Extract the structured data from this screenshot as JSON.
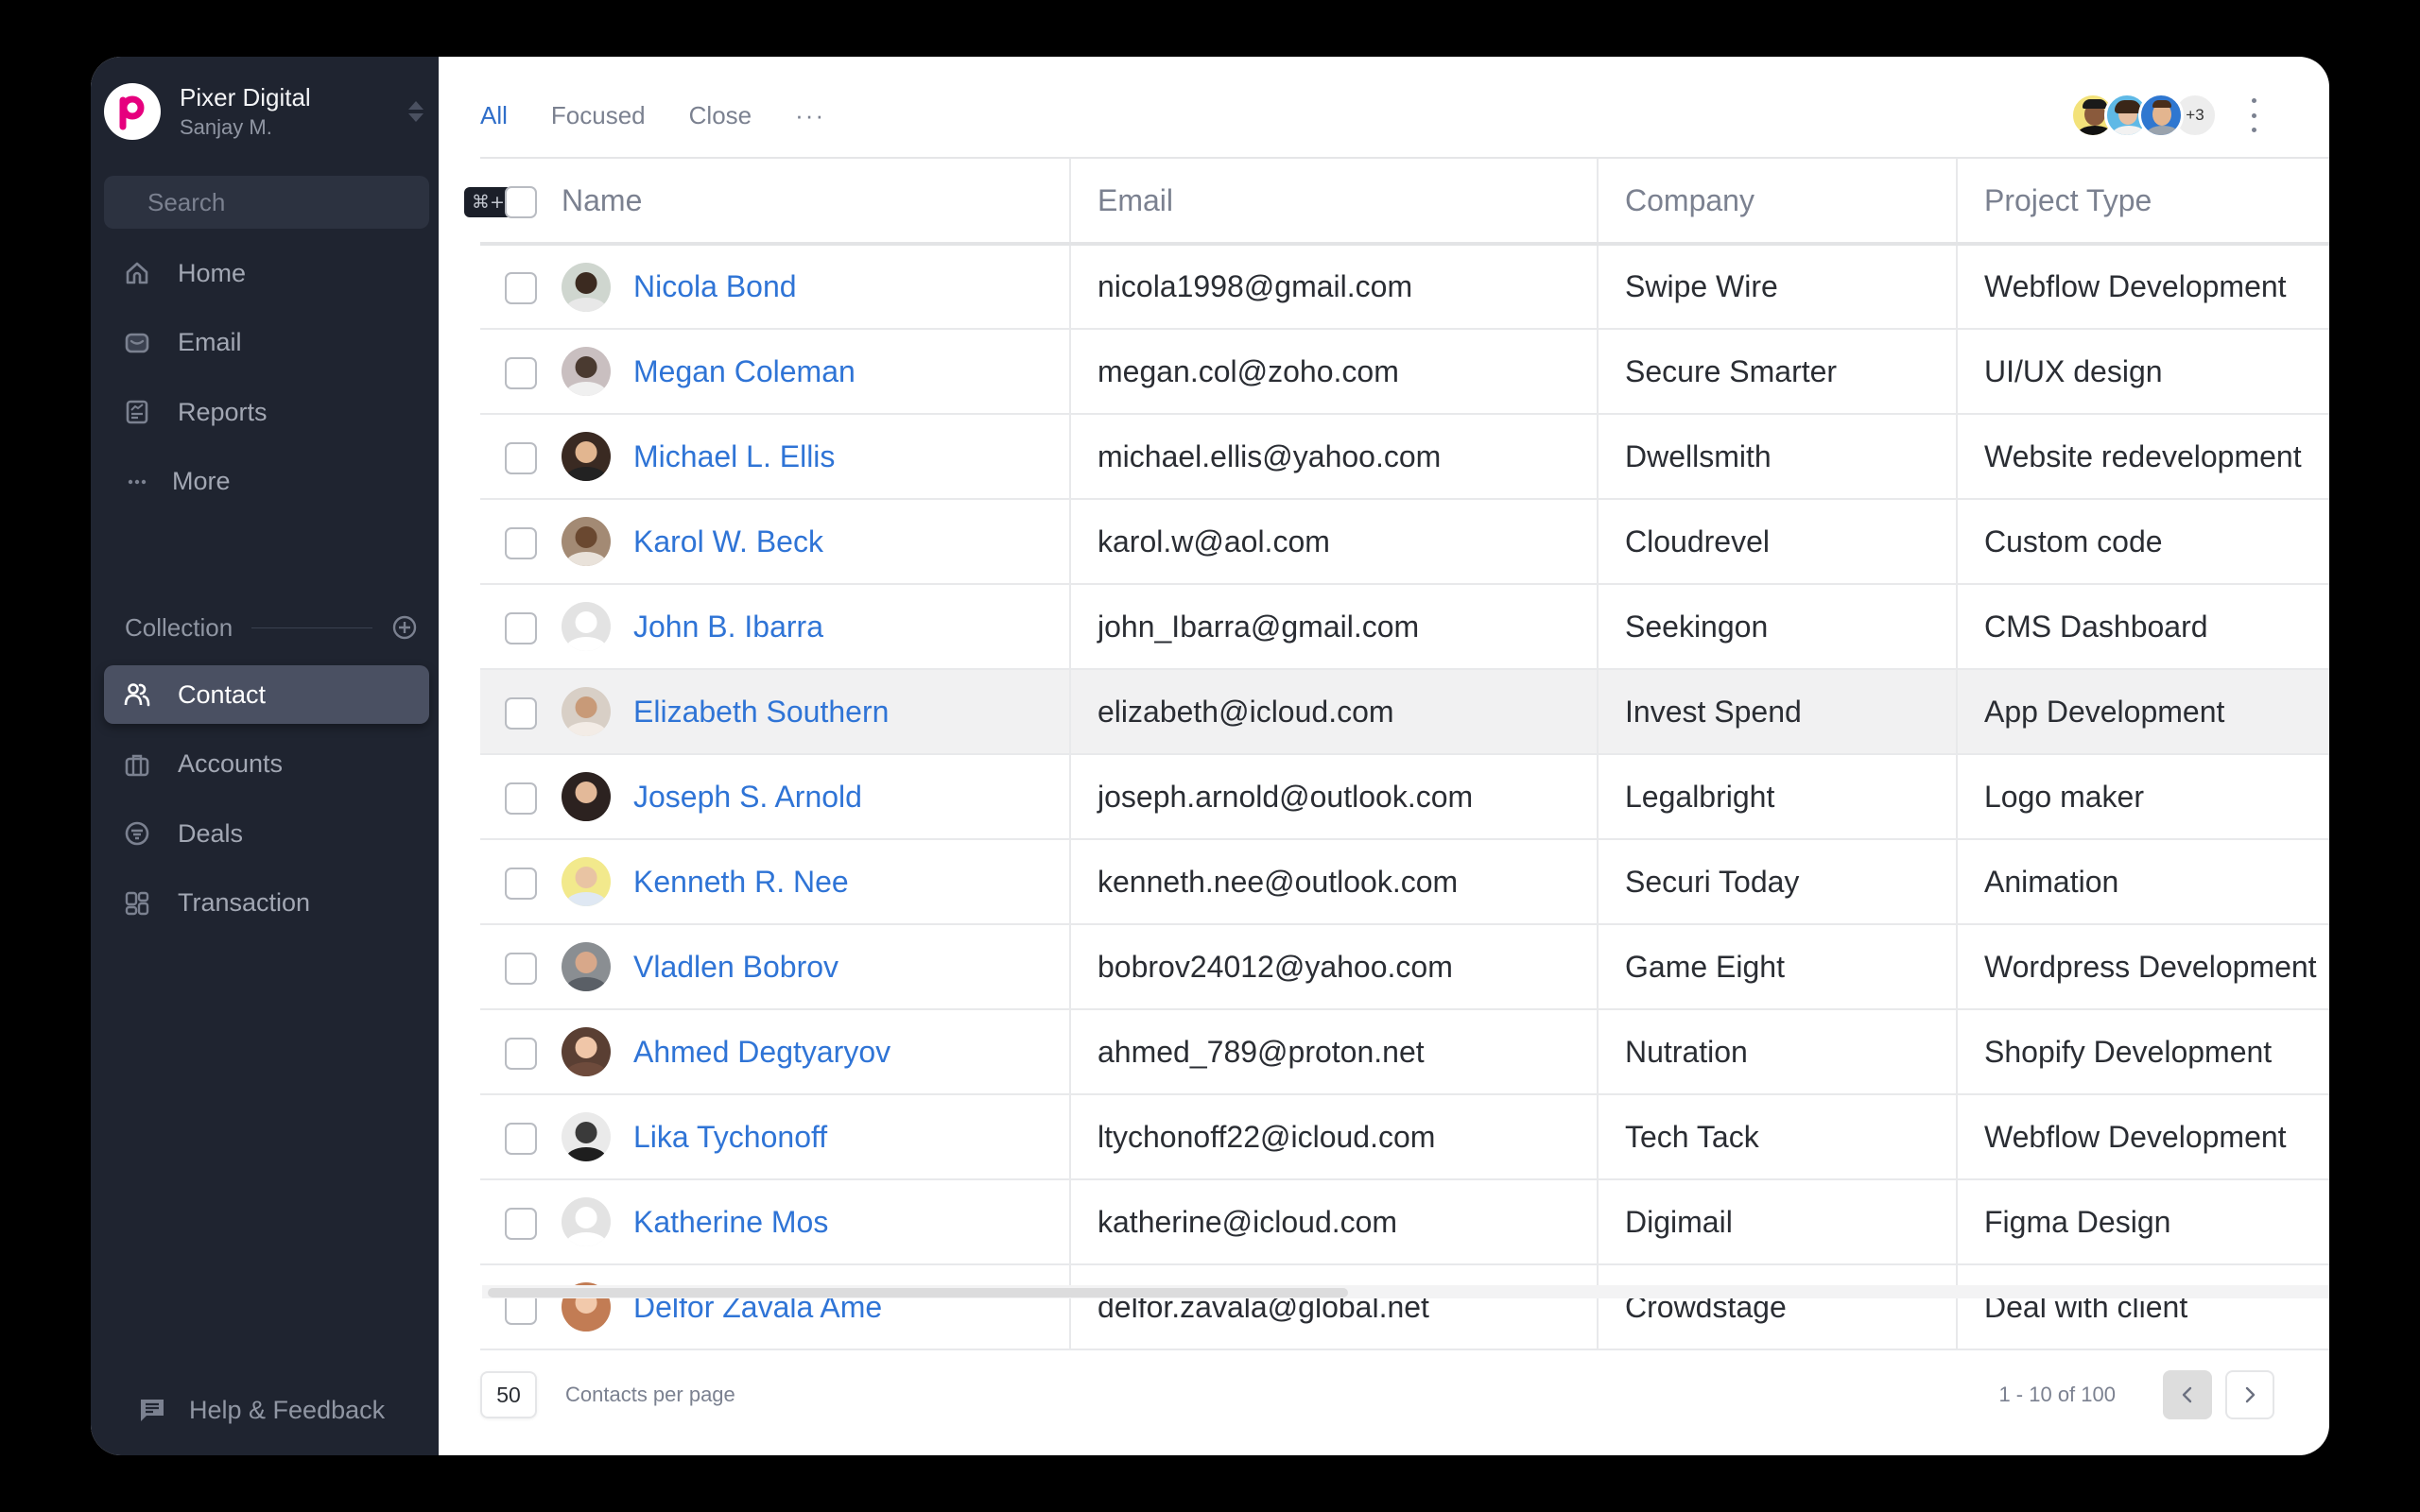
{
  "workspace": {
    "name": "Pixer Digital",
    "user": "Sanjay M.",
    "logo_letter": "p",
    "brand_color": "#e6007e"
  },
  "search": {
    "placeholder": "Search",
    "shortcut": "⌘+K"
  },
  "sidebar": {
    "items": [
      {
        "label": "Home",
        "icon": "home-icon"
      },
      {
        "label": "Email",
        "icon": "mail-icon"
      },
      {
        "label": "Reports",
        "icon": "report-icon"
      },
      {
        "label": "More",
        "icon": "more-horizontal-icon"
      }
    ],
    "collection_title": "Collection",
    "collection_items": [
      {
        "label": "Contact",
        "icon": "users-icon",
        "active": true
      },
      {
        "label": "Accounts",
        "icon": "briefcase-icon"
      },
      {
        "label": "Deals",
        "icon": "filter-circle-icon"
      },
      {
        "label": "Transaction",
        "icon": "grid-icon"
      }
    ],
    "help_label": "Help & Feedback"
  },
  "tabs": [
    {
      "label": "All",
      "active": true
    },
    {
      "label": "Focused"
    },
    {
      "label": "Close"
    }
  ],
  "tabs_more": "···",
  "collaborators": {
    "extra_count": "+3"
  },
  "table": {
    "columns": [
      "Name",
      "Email",
      "Company",
      "Project Type"
    ],
    "rows": [
      {
        "name": "Nicola Bond",
        "email": "nicola1998@gmail.com",
        "company": "Swipe Wire",
        "project": "Webflow Development"
      },
      {
        "name": "Megan Coleman",
        "email": "megan.col@zoho.com",
        "company": "Secure Smarter",
        "project": "UI/UX design"
      },
      {
        "name": "Michael L. Ellis",
        "email": "michael.ellis@yahoo.com",
        "company": "Dwellsmith",
        "project": "Website redevelopment"
      },
      {
        "name": "Karol W. Beck",
        "email": "karol.w@aol.com",
        "company": "Cloudrevel",
        "project": "Custom code"
      },
      {
        "name": "John B. Ibarra",
        "email": "john_Ibarra@gmail.com",
        "company": "Seekingon",
        "project": "CMS Dashboard"
      },
      {
        "name": "Elizabeth Southern",
        "email": "elizabeth@icloud.com",
        "company": "Invest Spend",
        "project": "App Development"
      },
      {
        "name": "Joseph S. Arnold",
        "email": "joseph.arnold@outlook.com",
        "company": "Legalbright",
        "project": "Logo maker"
      },
      {
        "name": "Kenneth R. Nee",
        "email": "kenneth.nee@outlook.com",
        "company": "Securi Today",
        "project": "Animation"
      },
      {
        "name": "Vladlen Bobrov",
        "email": "bobrov24012@yahoo.com",
        "company": "Game Eight",
        "project": "Wordpress Development"
      },
      {
        "name": "Ahmed Degtyaryov",
        "email": "ahmed_789@proton.net",
        "company": "Nutration",
        "project": "Shopify Development"
      },
      {
        "name": "Lika Tychonoff",
        "email": "ltychonoff22@icloud.com",
        "company": "Tech Tack",
        "project": "Webflow Development"
      },
      {
        "name": "Katherine Mos",
        "email": "katherine@icloud.com",
        "company": "Digimail",
        "project": "Figma Design"
      },
      {
        "name": "Delfor Zavala Ame",
        "email": "delfor.zavala@global.net",
        "company": "Crowdstage",
        "project": "Deal with client"
      }
    ]
  },
  "footer": {
    "per_page": "50",
    "per_page_label": "Contacts per page",
    "range": "1 - 10 of 100"
  },
  "colors": {
    "accent": "#2f74d6",
    "sidebar_bg": "#1f2430",
    "active_item_bg": "#4a5062"
  }
}
